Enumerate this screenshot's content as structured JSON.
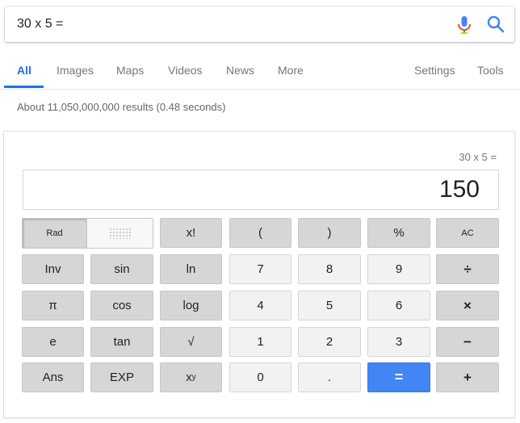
{
  "search": {
    "query": "30 x 5 =",
    "mic_icon": "mic-icon",
    "search_icon": "search-icon"
  },
  "tabs": {
    "all": "All",
    "images": "Images",
    "maps": "Maps",
    "videos": "Videos",
    "news": "News",
    "more": "More",
    "settings": "Settings",
    "tools": "Tools"
  },
  "results": {
    "stats": "About 11,050,000,000 results (0.48 seconds)"
  },
  "calculator": {
    "history": "30 x 5 =",
    "display": "150",
    "keys": {
      "rad": "Rad",
      "fact": "x!",
      "lparen": "(",
      "rparen": ")",
      "percent": "%",
      "ac": "AC",
      "inv": "Inv",
      "sin": "sin",
      "ln": "ln",
      "seven": "7",
      "eight": "8",
      "nine": "9",
      "divide": "÷",
      "pi": "π",
      "cos": "cos",
      "log": "log",
      "four": "4",
      "five": "5",
      "six": "6",
      "multiply": "×",
      "e": "e",
      "tan": "tan",
      "sqrt": "√",
      "one": "1",
      "two": "2",
      "three": "3",
      "minus": "−",
      "ans": "Ans",
      "exp": "EXP",
      "pow_base": "x",
      "pow_exp": "y",
      "zero": "0",
      "dot": ".",
      "equals": "=",
      "plus": "+"
    }
  },
  "colors": {
    "accent": "#1a73e8",
    "equals_key": "#4285f4",
    "dark_key": "#d6d6d6",
    "light_key": "#f2f2f2"
  }
}
